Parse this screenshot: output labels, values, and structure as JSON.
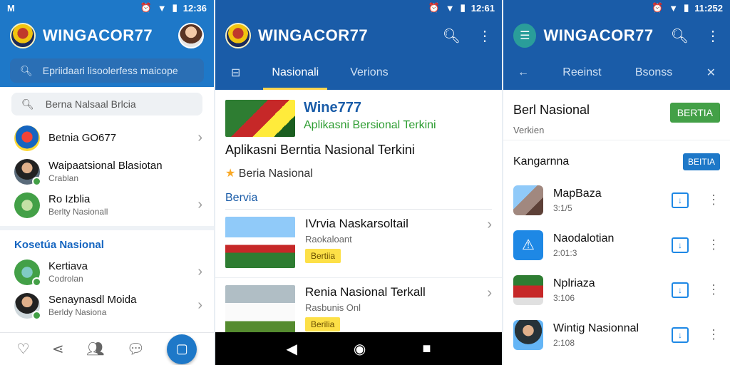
{
  "colors": {
    "blue_primary": "#1e78c8",
    "blue_dark": "#1a5ca8",
    "green": "#43a047",
    "yellow_badge": "#fde047"
  },
  "panel1": {
    "status": {
      "logo": "M",
      "time": "12:36"
    },
    "app_title": "WINGACOR77",
    "search_placeholder": "Epriidaari lisoolerfess maicope",
    "search2_placeholder": "Berna Nalsaal Brlcia",
    "chats": [
      {
        "title": "Betnia GO677",
        "sub": ""
      },
      {
        "title": "Waipaatsional Blasiotan",
        "sub": "Crablan"
      },
      {
        "title": "Ro Izblia",
        "sub": "Berlty Nasionall"
      }
    ],
    "section_title": "Kosetúa Nasional",
    "chats2": [
      {
        "title": "Kertiava",
        "sub": "Codrolan"
      },
      {
        "title": "Senaynasdl Moida",
        "sub": "Berldy Nasiona"
      }
    ]
  },
  "panel2": {
    "status": {
      "time": "12:61"
    },
    "app_title": "WINGACOR77",
    "tabs": [
      "Nasionali",
      "Verions"
    ],
    "hero_title": "Wine777",
    "hero_sub": "Aplikasni Bersional Terkini",
    "big_title": "Aplikasni Berntia Nasional Terkini",
    "rating_label": "Beria Nasional",
    "section": "Bervia",
    "news": [
      {
        "title": "IVrvia Naskarsoltail",
        "sub": "Raokaloant",
        "badge": "Bertiia"
      },
      {
        "title": "Renia Nasional Terkall",
        "sub": "Rasbunis Onl",
        "badge": "Berilia"
      }
    ]
  },
  "panel3": {
    "status": {
      "time": "11:252"
    },
    "app_title": "WINGACOR77",
    "tabs": [
      "Reeinst",
      "Bsonss"
    ],
    "head_title": "Berl Nasional",
    "head_sub": "Verkien",
    "head_button": "BERTIA",
    "row_head": "Kangarnna",
    "row_button": "BEITIA",
    "apps": [
      {
        "title": "MapBaza",
        "sub": "3:1/5"
      },
      {
        "title": "Naodalotian",
        "sub": "2:01:3"
      },
      {
        "title": "Nplriaza",
        "sub": "3:106"
      },
      {
        "title": "Wintig Nasionnal",
        "sub": "2:108"
      }
    ]
  }
}
